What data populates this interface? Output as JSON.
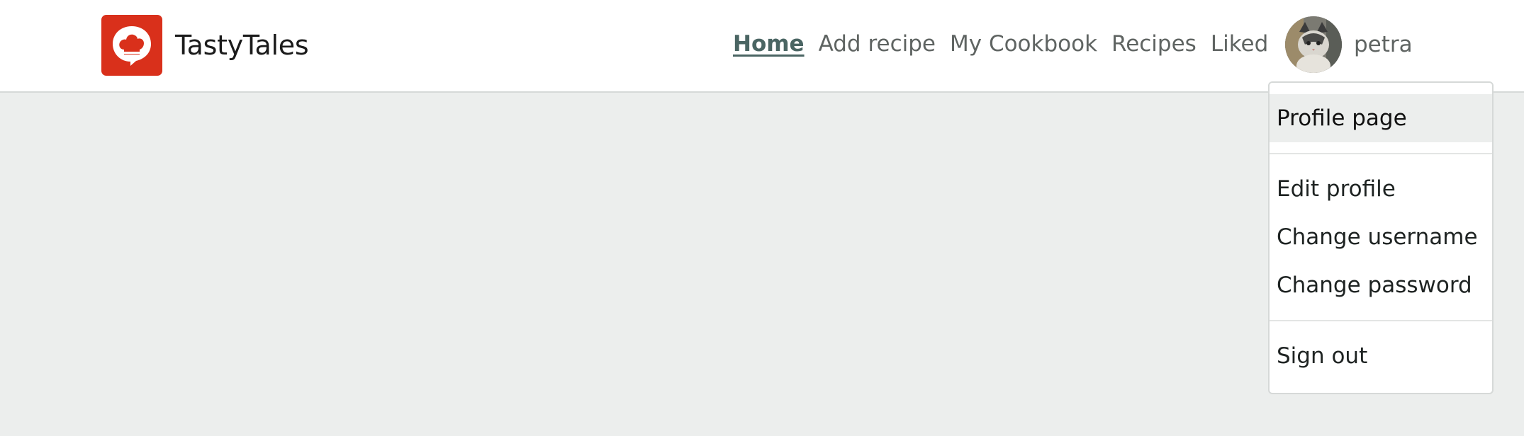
{
  "app": {
    "name": "TastyTales",
    "logo_icon": "chef-hat-speech-bubble-icon",
    "brand_color": "#d9301b"
  },
  "nav": {
    "items": [
      {
        "label": "Home",
        "active": true
      },
      {
        "label": "Add recipe"
      },
      {
        "label": "My Cookbook"
      },
      {
        "label": "Recipes"
      },
      {
        "label": "Liked"
      }
    ],
    "active_color": "#4a6563"
  },
  "user": {
    "username": "petra",
    "avatar_icon": "cat-avatar"
  },
  "dropdown": {
    "items": [
      {
        "label": "Profile page"
      },
      {
        "label": "Edit profile"
      },
      {
        "label": "Change username"
      },
      {
        "label": "Change password"
      },
      {
        "label": "Sign out"
      }
    ]
  }
}
